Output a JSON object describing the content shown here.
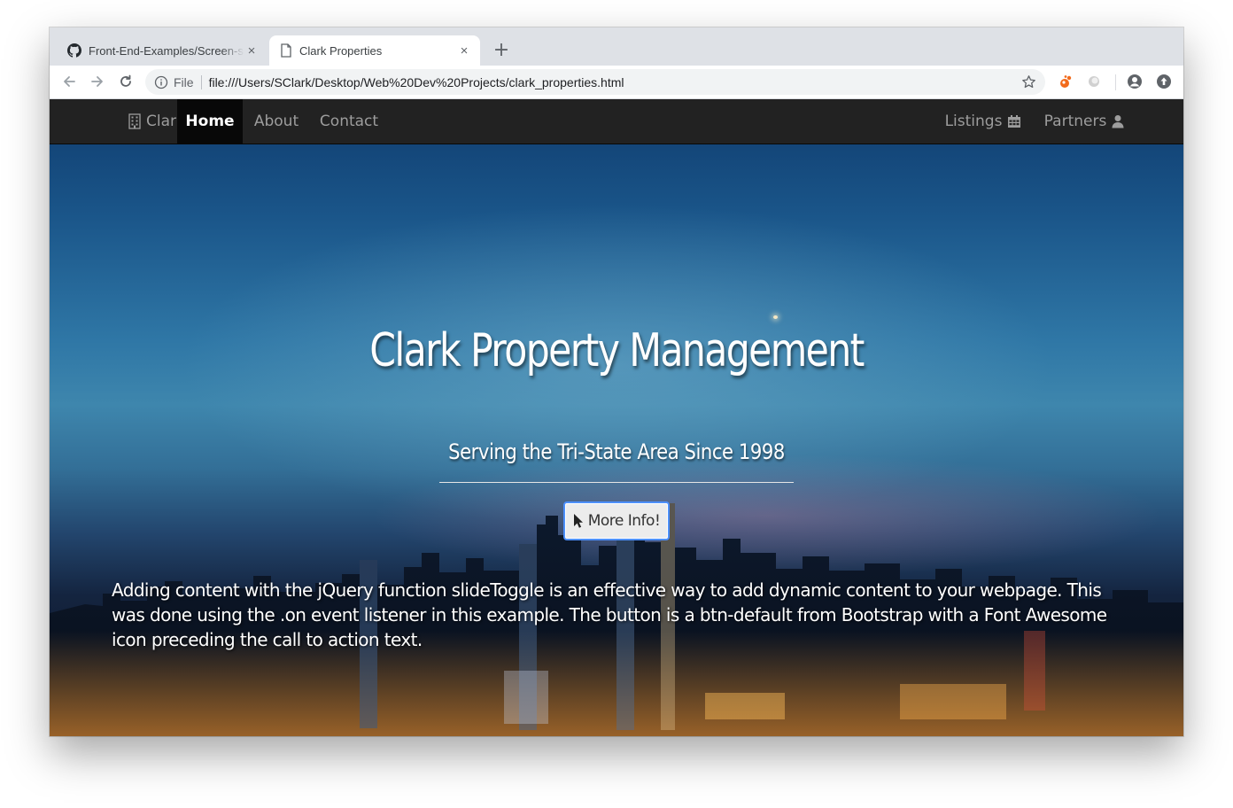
{
  "browser": {
    "tabs": [
      {
        "title": "Front-End-Examples/Screen-s",
        "icon": "github-icon",
        "active": false
      },
      {
        "title": "Clark Properties",
        "icon": "page-icon",
        "active": true
      }
    ],
    "new_tab_label": "+",
    "close_label": "×",
    "omnibox": {
      "scheme_label": "File",
      "url": "file:///Users/SClark/Desktop/Web%20Dev%20Projects/clark_properties.html"
    }
  },
  "navbar": {
    "brand": "Clark",
    "brand_icon": "building-icon",
    "links": [
      {
        "label": "Home",
        "active": true
      },
      {
        "label": "About",
        "active": false
      },
      {
        "label": "Contact",
        "active": false
      }
    ],
    "right_links": [
      {
        "label": "Listings",
        "icon": "calendar-icon"
      },
      {
        "label": "Partners",
        "icon": "user-icon"
      }
    ],
    "background": "#222222",
    "active_background": "#080808"
  },
  "hero": {
    "title": "Clark Property Management",
    "subtitle": "Serving the Tri-State Area Since 1998",
    "button_label": "More Info!",
    "button_icon": "mouse-pointer-icon",
    "body": "Adding content with the jQuery function slideToggle is an effective way to add dynamic content to your webpage. This was done using the .on event listener in this example. The button is a btn-default from Bootstrap with a Font Awesome icon preceding the call to action text."
  },
  "colors": {
    "focus_ring": "#4d90fe",
    "sky_top": "#0f3c6e",
    "sky_mid": "#3e86ad"
  }
}
